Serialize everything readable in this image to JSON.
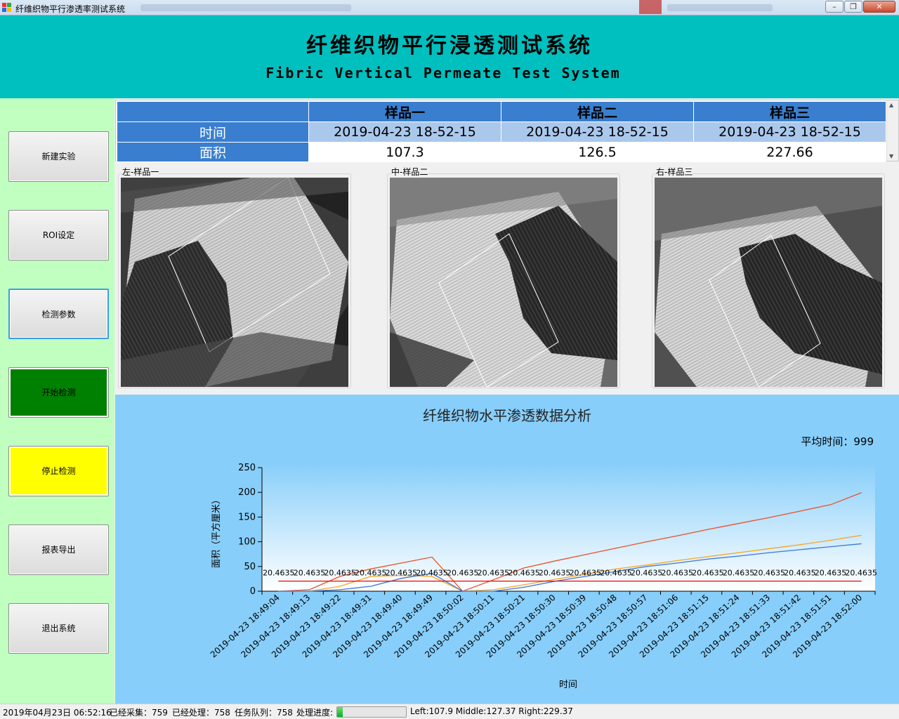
{
  "window": {
    "title": "纤维织物平行渗透率测试系统"
  },
  "header": {
    "title_cn": "纤维织物平行浸透测试系统",
    "title_en": "Fibric Vertical Permeate Test System"
  },
  "sidebar": {
    "buttons": [
      {
        "label": "新建实验"
      },
      {
        "label": "ROI设定"
      },
      {
        "label": "检测参数"
      },
      {
        "label": "开始检测"
      },
      {
        "label": "停止检测"
      },
      {
        "label": "报表导出"
      },
      {
        "label": "退出系统"
      }
    ]
  },
  "grid": {
    "columns": [
      "样品一",
      "样品二",
      "样品三"
    ],
    "rows": [
      {
        "header": "时间",
        "cells": [
          "2019-04-23 18-52-15",
          "2019-04-23 18-52-15",
          "2019-04-23 18-52-15"
        ]
      },
      {
        "header": "面积",
        "cells": [
          "107.3",
          "126.5",
          "227.66"
        ]
      }
    ]
  },
  "images": {
    "left_label": "左-样品一",
    "middle_label": "中-样品二",
    "right_label": "右-样品三"
  },
  "chart_panel": {
    "avg_label": "平均时间：999"
  },
  "chart_data": {
    "type": "line",
    "title": "纤维织物水平渗透数据分析",
    "xlabel": "时间",
    "ylabel": "面积（平方厘米）",
    "ylim": [
      0,
      250
    ],
    "yticks": [
      0,
      50,
      100,
      150,
      200,
      250
    ],
    "categories": [
      "2019-04-23 18:49:04",
      "2019-04-23 18:49:13",
      "2019-04-23 18:49:22",
      "2019-04-23 18:49:31",
      "2019-04-23 18:49:40",
      "2019-04-23 18:49:49",
      "2019-04-23 18:50:02",
      "2019-04-23 18:50:11",
      "2019-04-23 18:50:21",
      "2019-04-23 18:50:30",
      "2019-04-23 18:50:39",
      "2019-04-23 18:50:48",
      "2019-04-23 18:50:57",
      "2019-04-23 18:51:06",
      "2019-04-23 18:51:15",
      "2019-04-23 18:51:24",
      "2019-04-23 18:51:33",
      "2019-04-23 18:51:42",
      "2019-04-23 18:51:51",
      "2019-04-23 18:52:00"
    ],
    "series": [
      {
        "color": "#e8512a",
        "values": [
          0,
          3,
          30,
          45,
          57,
          69,
          0,
          23,
          47,
          61,
          74,
          87,
          100,
          112,
          125,
          137,
          149,
          162,
          175,
          199
        ]
      },
      {
        "color": "#f5a623",
        "values": [
          0,
          0,
          10,
          30,
          32,
          30,
          0,
          3,
          13,
          24,
          34,
          45,
          53,
          62,
          70,
          78,
          86,
          94,
          103,
          113
        ]
      },
      {
        "color": "#3c78d8",
        "values": [
          0,
          0,
          3,
          10,
          26,
          36,
          0,
          0,
          8,
          20,
          30,
          40,
          50,
          57,
          65,
          71,
          78,
          84,
          90,
          96
        ]
      },
      {
        "color": "#ff0000",
        "values": [
          20.4635,
          20.4635,
          20.4635,
          20.4635,
          20.4635,
          20.4635,
          20.4635,
          20.4635,
          20.4635,
          20.4635,
          20.4635,
          20.4635,
          20.4635,
          20.4635,
          20.4635,
          20.4635,
          20.4635,
          20.4635,
          20.4635,
          20.4635
        ],
        "data_label": "20.4635"
      }
    ]
  },
  "status": {
    "date": "2019年04月23日 06:52:16",
    "collected": "已经采集：759",
    "processed": "已经处理：758",
    "queue": "任务队列：758",
    "progress_label": "处理进度:",
    "progress": 0.08,
    "readout": "Left:107.9 Middle:127.37 Right:229.37"
  }
}
